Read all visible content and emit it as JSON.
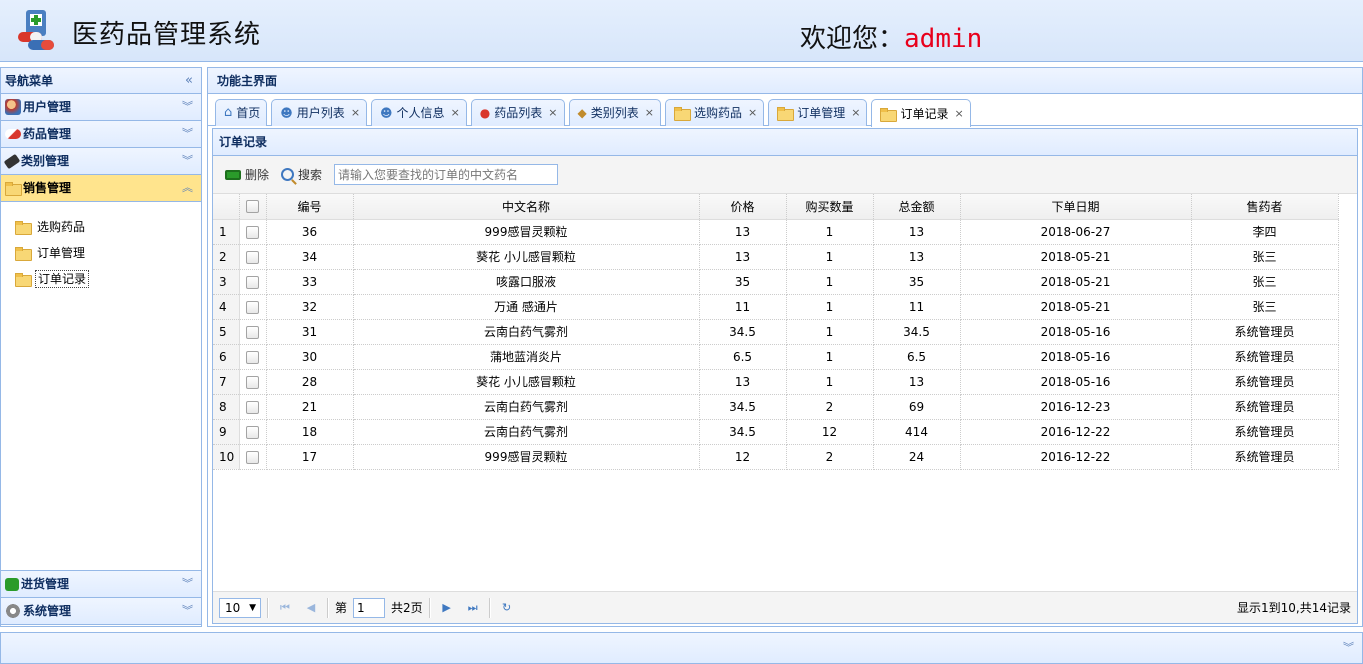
{
  "header": {
    "title": "医药品管理系统",
    "welcome_label": "欢迎您：",
    "username": "admin"
  },
  "west": {
    "title": "导航菜单",
    "sections": [
      {
        "label": "用户管理"
      },
      {
        "label": "药品管理"
      },
      {
        "label": "类别管理"
      },
      {
        "label": "销售管理",
        "items": [
          "选购药品",
          "订单管理",
          "订单记录"
        ]
      },
      {
        "label": "进货管理"
      },
      {
        "label": "系统管理"
      }
    ]
  },
  "center": {
    "title": "功能主界面",
    "tabs": [
      "首页",
      "用户列表",
      "个人信息",
      "药品列表",
      "类别列表",
      "选购药品",
      "订单管理",
      "订单记录"
    ],
    "panel_title": "订单记录",
    "toolbar": {
      "delete_label": "删除",
      "search_label": "搜索",
      "search_placeholder": "请输入您要查找的订单的中文药名"
    },
    "columns": [
      "编号",
      "中文名称",
      "价格",
      "购买数量",
      "总金额",
      "下单日期",
      "售药者"
    ],
    "rows": [
      [
        "1",
        "36",
        "999感冒灵颗粒",
        "13",
        "1",
        "13",
        "2018-06-27",
        "李四"
      ],
      [
        "2",
        "34",
        "葵花 小儿感冒颗粒",
        "13",
        "1",
        "13",
        "2018-05-21",
        "张三"
      ],
      [
        "3",
        "33",
        "咳露口服液",
        "35",
        "1",
        "35",
        "2018-05-21",
        "张三"
      ],
      [
        "4",
        "32",
        "万通 感通片",
        "11",
        "1",
        "11",
        "2018-05-21",
        "张三"
      ],
      [
        "5",
        "31",
        "云南白药气雾剂",
        "34.5",
        "1",
        "34.5",
        "2018-05-16",
        "系统管理员"
      ],
      [
        "6",
        "30",
        "蒲地蓝消炎片",
        "6.5",
        "1",
        "6.5",
        "2018-05-16",
        "系统管理员"
      ],
      [
        "7",
        "28",
        "葵花 小儿感冒颗粒",
        "13",
        "1",
        "13",
        "2018-05-16",
        "系统管理员"
      ],
      [
        "8",
        "21",
        "云南白药气雾剂",
        "34.5",
        "2",
        "69",
        "2016-12-23",
        "系统管理员"
      ],
      [
        "9",
        "18",
        "云南白药气雾剂",
        "34.5",
        "12",
        "414",
        "2016-12-22",
        "系统管理员"
      ],
      [
        "10",
        "17",
        "999感冒灵颗粒",
        "12",
        "2",
        "24",
        "2016-12-22",
        "系统管理员"
      ]
    ],
    "pager": {
      "page_size": "10",
      "page_prefix": "第",
      "page_value": "1",
      "total_pages": "共2页",
      "info": "显示1到10,共14记录"
    }
  }
}
